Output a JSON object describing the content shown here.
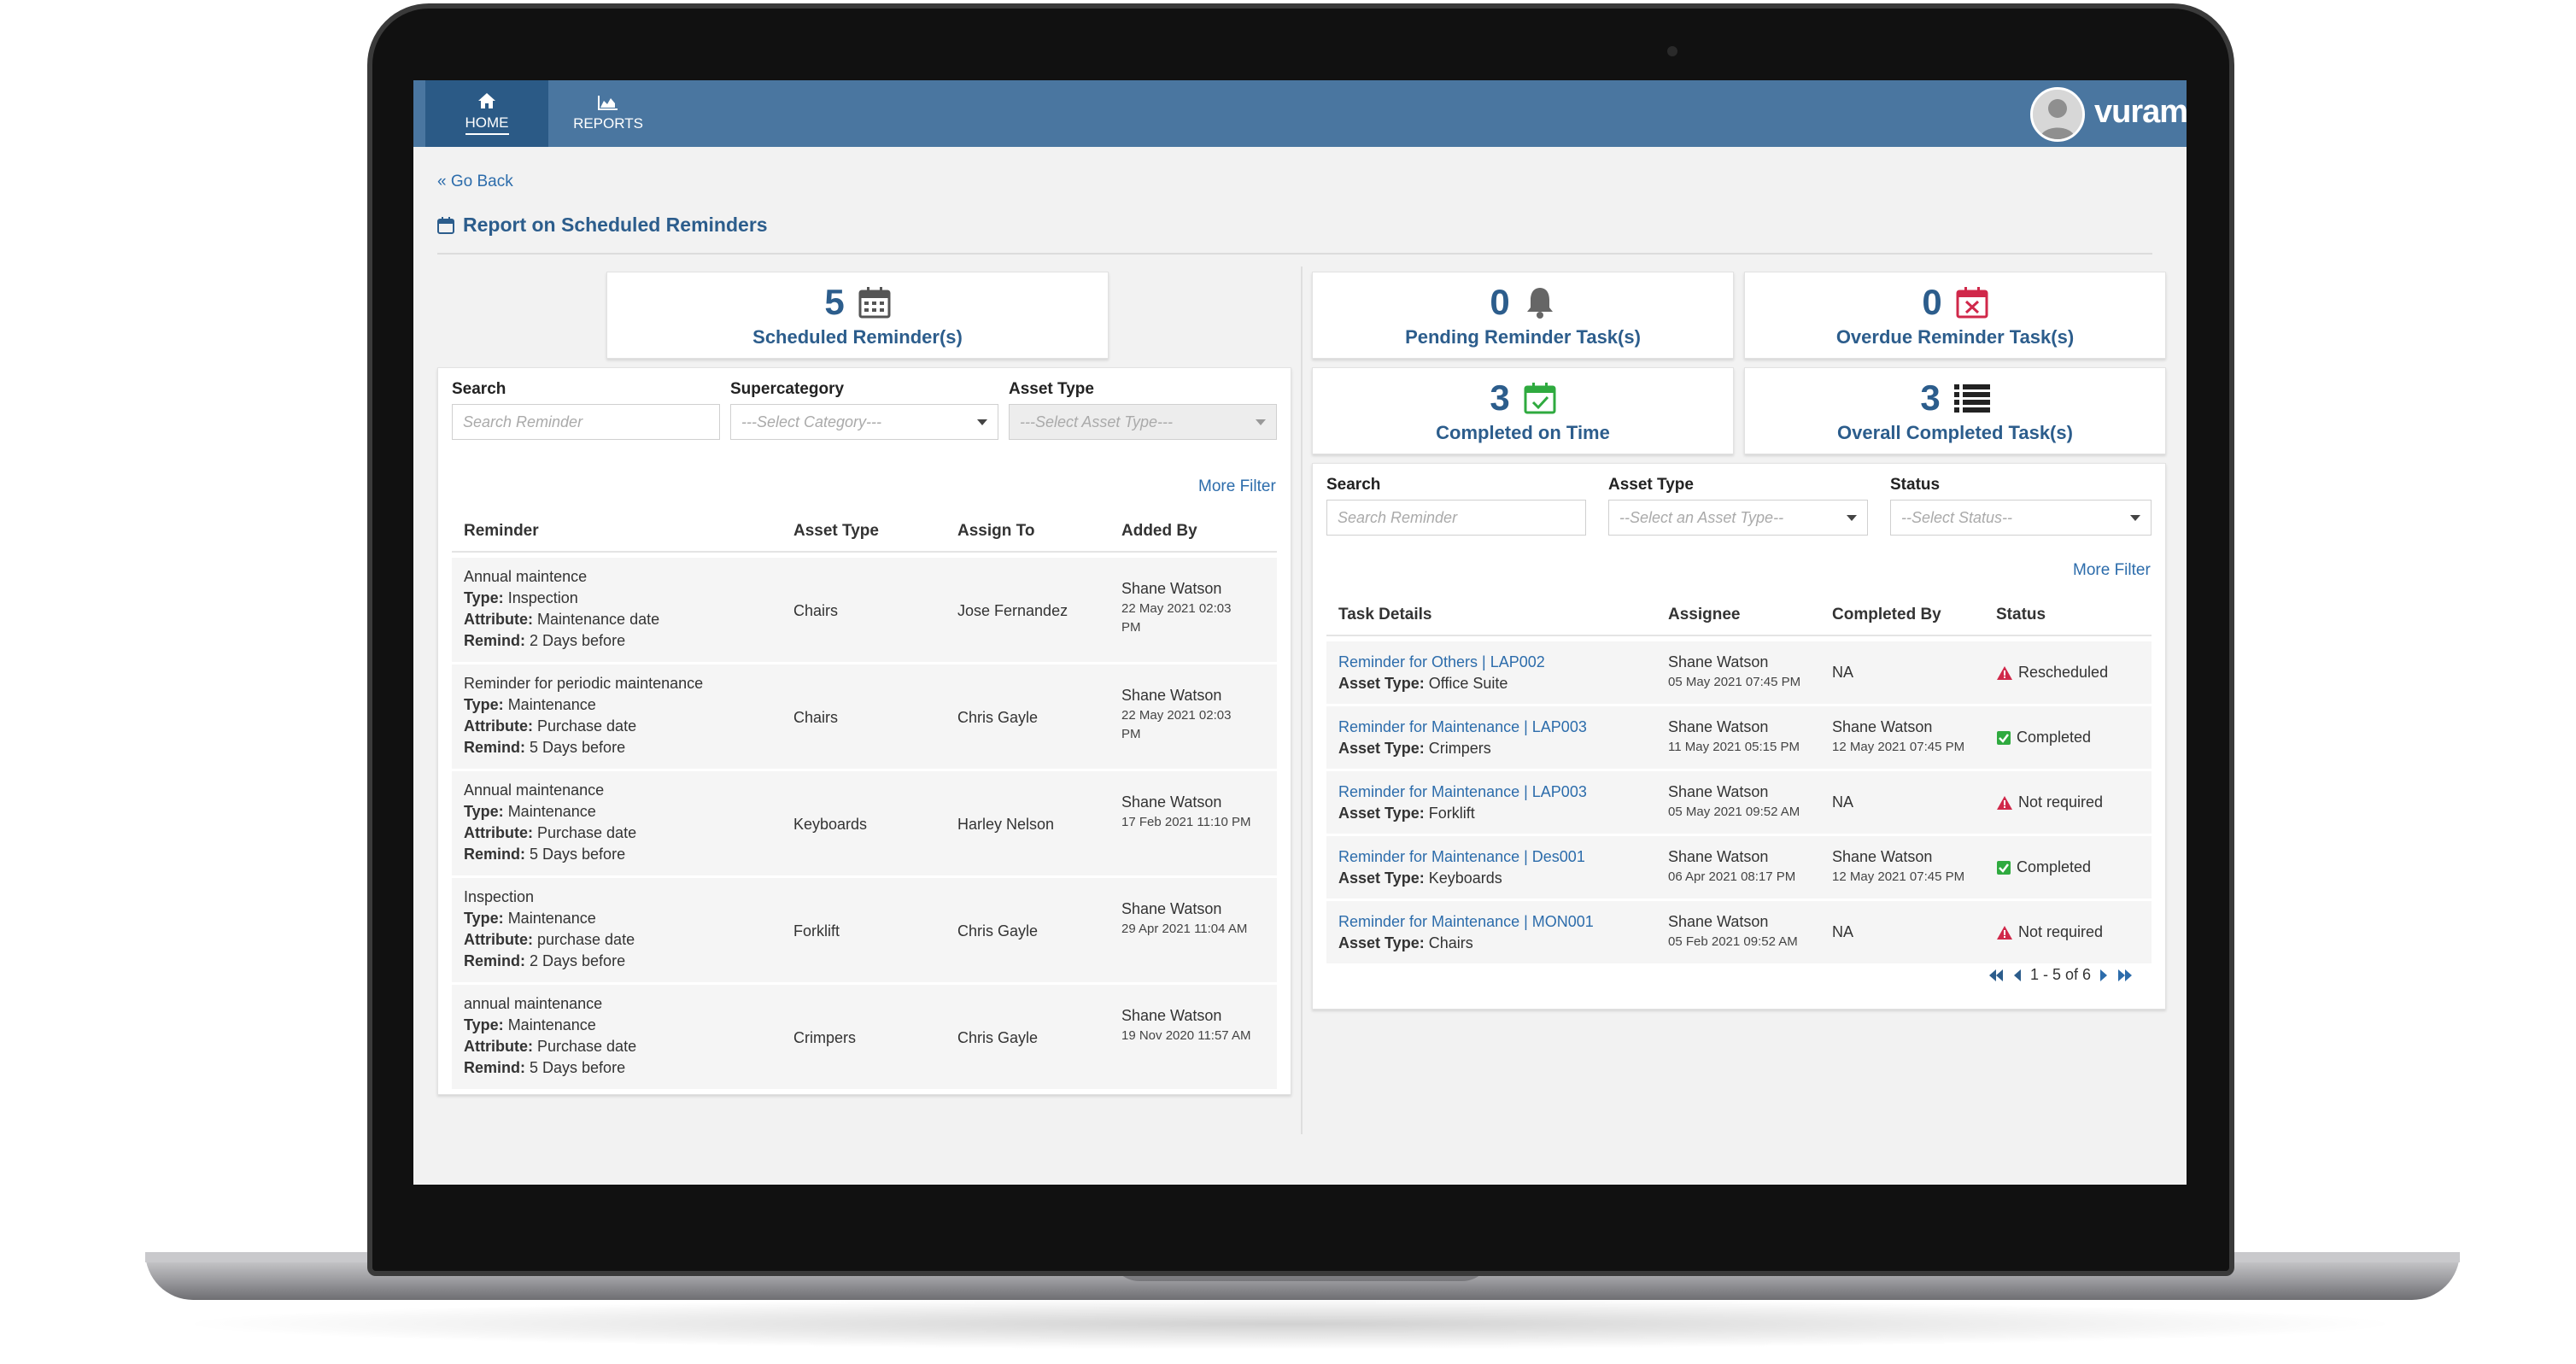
{
  "nav": {
    "home": "HOME",
    "reports": "REPORTS"
  },
  "brand": {
    "logo": "vuram"
  },
  "page": {
    "go_back": "« Go Back",
    "title": "Report on Scheduled Reminders"
  },
  "left": {
    "stat": {
      "value": "5",
      "label": "Scheduled Reminder(s)",
      "icon": "calendar-icon"
    },
    "filters": {
      "search_label": "Search",
      "search_placeholder": "Search Reminder",
      "category_label": "Supercategory",
      "category_placeholder": "---Select Category---",
      "asset_label": "Asset Type",
      "asset_placeholder": "---Select Asset Type---"
    },
    "more_filter": "More Filter",
    "columns": [
      "Reminder",
      "Asset Type",
      "Assign To",
      "Added By"
    ],
    "rows": [
      {
        "title": "Annual maintence",
        "type_label": "Type:",
        "type": "Inspection",
        "attr_label": "Attribute:",
        "attr": "Maintenance date",
        "remind_label": "Remind:",
        "remind": "2 Days before",
        "asset": "Chairs",
        "assign": "Jose Fernandez",
        "added_by": "Shane Watson",
        "added_on_1": "22 May 2021 02:03",
        "added_on_2": "PM"
      },
      {
        "title": "Reminder for periodic maintenance",
        "type_label": "Type:",
        "type": "Maintenance",
        "attr_label": "Attribute:",
        "attr": "Purchase date",
        "remind_label": "Remind:",
        "remind": "5 Days before",
        "asset": "Chairs",
        "assign": "Chris Gayle",
        "added_by": "Shane Watson",
        "added_on_1": "22 May 2021 02:03",
        "added_on_2": "PM"
      },
      {
        "title": "Annual maintenance",
        "type_label": "Type:",
        "type": "Maintenance",
        "attr_label": "Attribute:",
        "attr": "Purchase date",
        "remind_label": "Remind:",
        "remind": "5 Days before",
        "asset": "Keyboards",
        "assign": "Harley Nelson",
        "added_by": "Shane Watson",
        "added_on_1": "17 Feb 2021 11:10 PM",
        "added_on_2": ""
      },
      {
        "title": "Inspection",
        "type_label": "Type:",
        "type": "Maintenance",
        "attr_label": "Attribute:",
        "attr": "purchase date",
        "remind_label": "Remind:",
        "remind": "2 Days before",
        "asset": "Forklift",
        "assign": "Chris Gayle",
        "added_by": "Shane Watson",
        "added_on_1": "29 Apr 2021 11:04 AM",
        "added_on_2": ""
      },
      {
        "title": "annual maintenance",
        "type_label": "Type:",
        "type": "Maintenance",
        "attr_label": "Attribute:",
        "attr": "Purchase date",
        "remind_label": "Remind:",
        "remind": "5 Days before",
        "asset": "Crimpers",
        "assign": "Chris Gayle",
        "added_by": "Shane Watson",
        "added_on_1": "19 Nov 2020 11:57 AM",
        "added_on_2": ""
      }
    ]
  },
  "right": {
    "stats": [
      {
        "value": "0",
        "label": "Pending Reminder Task(s)",
        "icon": "bell-icon"
      },
      {
        "value": "0",
        "label": "Overdue Reminder Task(s)",
        "icon": "calendar-x-icon"
      },
      {
        "value": "3",
        "label": "Completed on Time",
        "icon": "calendar-check-icon"
      },
      {
        "value": "3",
        "label": "Overall Completed Task(s)",
        "icon": "list-icon"
      }
    ],
    "filters": {
      "search_label": "Search",
      "search_placeholder": "Search Reminder",
      "asset_label": "Asset Type",
      "asset_placeholder": "--Select an Asset Type--",
      "status_label": "Status",
      "status_placeholder": "--Select Status--"
    },
    "more_filter": "More Filter",
    "columns": [
      "Task Details",
      "Assignee",
      "Completed By",
      "Status"
    ],
    "rows": [
      {
        "task": "Reminder for Others | LAP002",
        "asset_label": "Asset Type:",
        "asset": "Office Suite",
        "assignee": "Shane Watson",
        "assigned_on": "05 May 2021 07:45 PM",
        "completed_by": "NA",
        "completed_on": "",
        "status": "Rescheduled",
        "status_kind": "warning"
      },
      {
        "task": "Reminder for Maintenance | LAP003",
        "asset_label": "Asset Type:",
        "asset": "Crimpers",
        "assignee": "Shane Watson",
        "assigned_on": "11 May 2021 05:15 PM",
        "completed_by": "Shane Watson",
        "completed_on": "12 May 2021 07:45 PM",
        "status": "Completed",
        "status_kind": "success"
      },
      {
        "task": "Reminder for Maintenance | LAP003",
        "asset_label": "Asset Type:",
        "asset": "Forklift",
        "assignee": "Shane Watson",
        "assigned_on": "05 May 2021 09:52 AM",
        "completed_by": "NA",
        "completed_on": "",
        "status": "Not required",
        "status_kind": "warning"
      },
      {
        "task": "Reminder for Maintenance | Des001",
        "asset_label": "Asset Type:",
        "asset": "Keyboards",
        "assignee": "Shane Watson",
        "assigned_on": "06 Apr 2021 08:17 PM",
        "completed_by": "Shane Watson",
        "completed_on": "12 May 2021 07:45 PM",
        "status": "Completed",
        "status_kind": "success"
      },
      {
        "task": "Reminder for Maintenance | MON001",
        "asset_label": "Asset Type:",
        "asset": "Chairs",
        "assignee": "Shane Watson",
        "assigned_on": "05 Feb 2021 09:52 AM",
        "completed_by": "NA",
        "completed_on": "",
        "status": "Not required",
        "status_kind": "warning"
      }
    ],
    "pager": "1 - 5 of 6"
  },
  "colors": {
    "header": "#4a76a0",
    "header_active": "#2b5a86",
    "accent": "#2c5d8c",
    "link": "#2c6cab",
    "danger": "#d0284a",
    "success": "#2faa3f"
  }
}
